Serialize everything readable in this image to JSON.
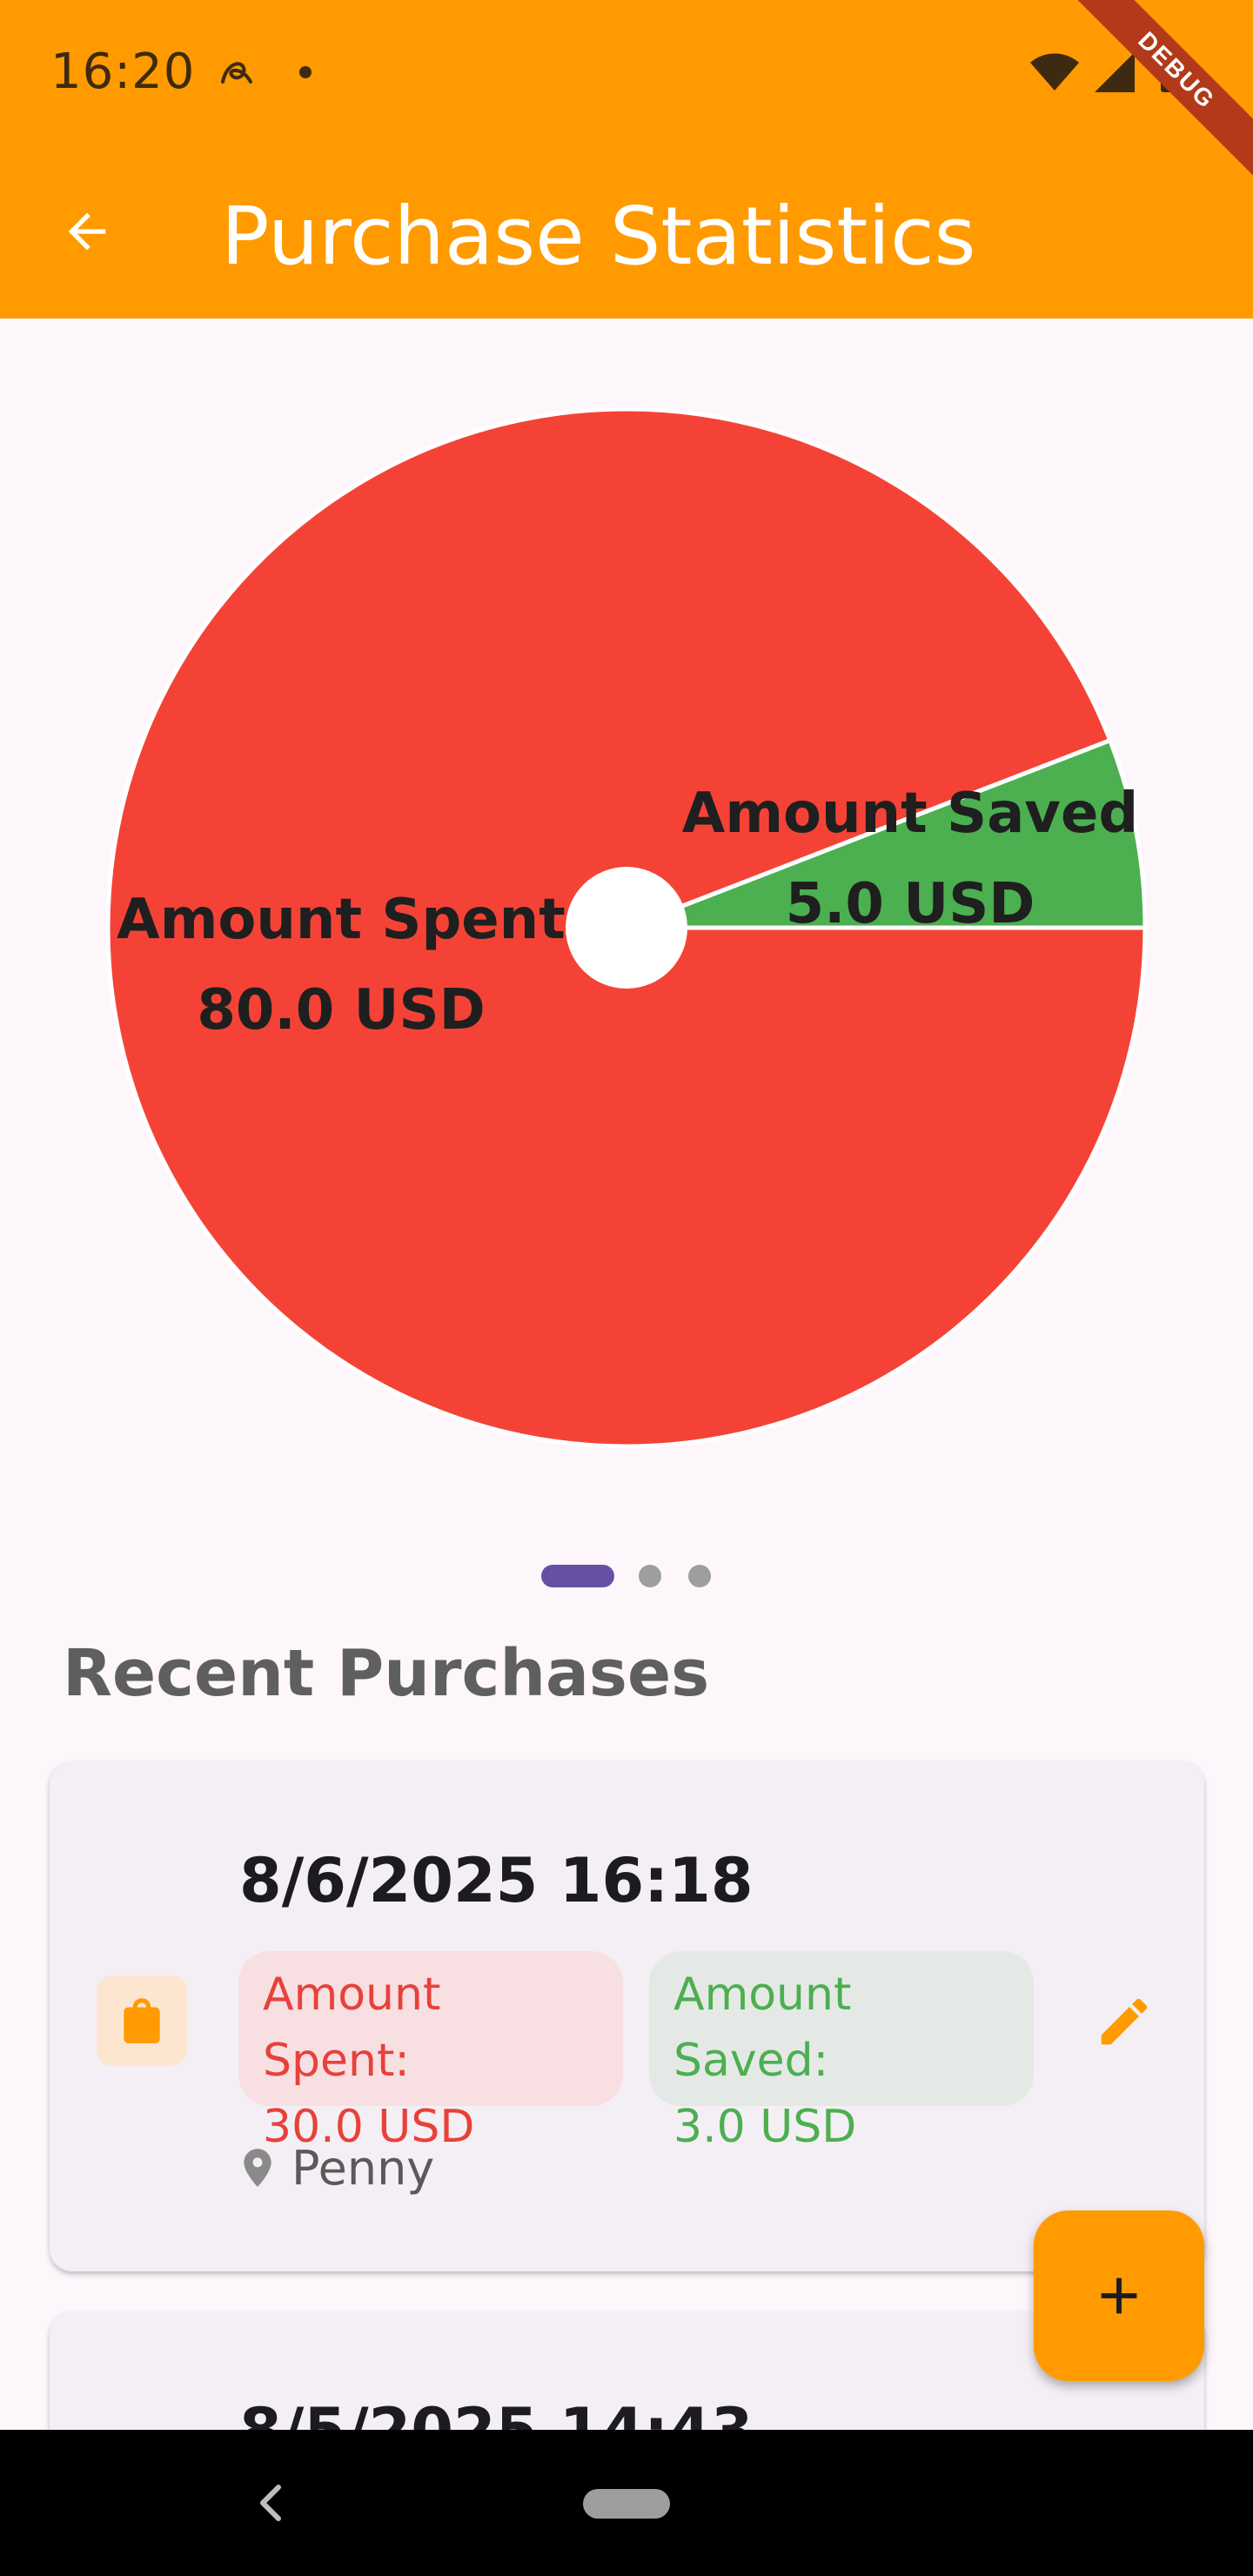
{
  "status_bar": {
    "time": "16:20",
    "icons": [
      "at-sign-icon",
      "dot-icon",
      "wifi-icon",
      "signal-icon",
      "battery-icon"
    ]
  },
  "app_bar": {
    "title": "Purchase Statistics",
    "back_icon": "arrow-back-icon",
    "background": "#ff9a00"
  },
  "debug_banner": "DEBUG",
  "chart_data": {
    "type": "pie",
    "labels": [
      "Amount Spent",
      "Amount Saved"
    ],
    "values": [
      80.0,
      5.0
    ],
    "value_labels": [
      "80.0 USD",
      "5.0 USD"
    ],
    "colors": [
      "#f44336",
      "#4caf50"
    ],
    "center_hole": true
  },
  "page_indicator": {
    "count": 3,
    "active": 0
  },
  "section_title": "Recent Purchases",
  "purchases": [
    {
      "date": "8/6/2025 16:18",
      "spent_label": "Amount Spent:",
      "spent_value": "30.0 USD",
      "saved_label": "Amount Saved:",
      "saved_value": "3.0 USD",
      "location": "Penny",
      "icon": "shopping-bag-icon"
    },
    {
      "date": "8/5/2025 14:43"
    }
  ],
  "fab": {
    "icon": "add-icon"
  },
  "nav_bar": {
    "back_icon": "nav-back-icon",
    "home_icon": "nav-home-pill"
  }
}
